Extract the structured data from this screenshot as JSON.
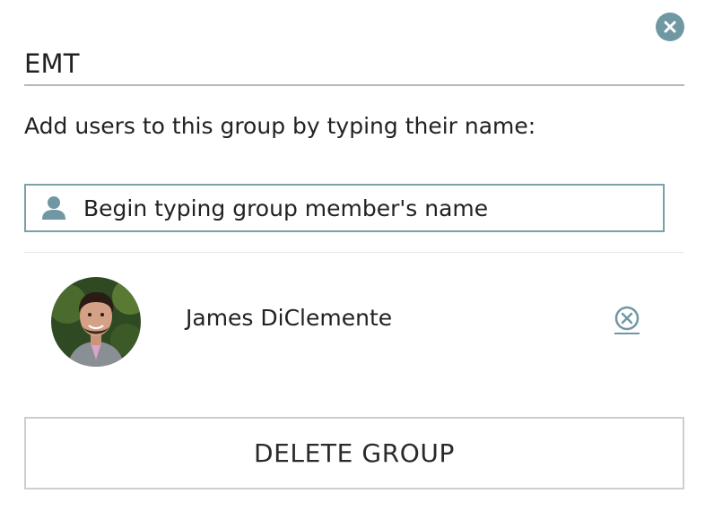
{
  "dialog": {
    "group_name": "EMT",
    "instructions": "Add users to this group by typing their name:",
    "search": {
      "placeholder": "Begin typing group member's name",
      "value": ""
    },
    "members": [
      {
        "name": "James DiClemente"
      }
    ],
    "delete_label": "DELETE GROUP"
  },
  "colors": {
    "accent": "#6f98a3",
    "input_border": "#7d9fa9",
    "divider": "#b8b8b8",
    "button_border": "#cfcfcf"
  },
  "icons": {
    "close": "close-icon",
    "user": "user-icon",
    "remove": "remove-member-icon"
  }
}
